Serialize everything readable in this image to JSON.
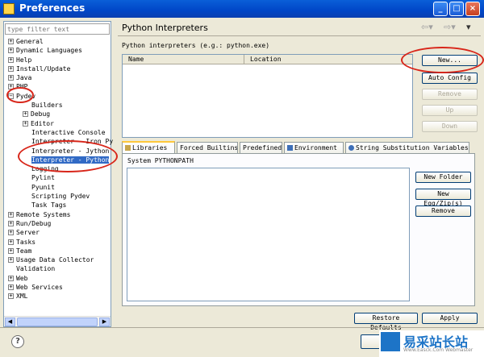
{
  "window": {
    "title": "Preferences"
  },
  "filter": {
    "placeholder": "type filter text"
  },
  "tree": [
    {
      "label": "General",
      "expander": "+",
      "level": 0
    },
    {
      "label": "Dynamic Languages",
      "expander": "+",
      "level": 0
    },
    {
      "label": "Help",
      "expander": "+",
      "level": 0
    },
    {
      "label": "Install/Update",
      "expander": "+",
      "level": 0
    },
    {
      "label": "Java",
      "expander": "+",
      "level": 0
    },
    {
      "label": "PHP",
      "expander": "+",
      "level": 0
    },
    {
      "label": "Pydev",
      "expander": "−",
      "level": 0
    },
    {
      "label": "Builders",
      "expander": "",
      "level": 1
    },
    {
      "label": "Debug",
      "expander": "+",
      "level": 1
    },
    {
      "label": "Editor",
      "expander": "+",
      "level": 1
    },
    {
      "label": "Interactive Console",
      "expander": "",
      "level": 1
    },
    {
      "label": "Interpreter - Iron Py",
      "expander": "",
      "level": 1
    },
    {
      "label": "Interpreter - Jython",
      "expander": "",
      "level": 1
    },
    {
      "label": "Interpreter - Python",
      "expander": "",
      "level": 1,
      "selected": true
    },
    {
      "label": "Logging",
      "expander": "",
      "level": 1
    },
    {
      "label": "Pylint",
      "expander": "",
      "level": 1
    },
    {
      "label": "Pyunit",
      "expander": "",
      "level": 1
    },
    {
      "label": "Scripting Pydev",
      "expander": "",
      "level": 1
    },
    {
      "label": "Task Tags",
      "expander": "",
      "level": 1
    },
    {
      "label": "Remote Systems",
      "expander": "+",
      "level": 0
    },
    {
      "label": "Run/Debug",
      "expander": "+",
      "level": 0
    },
    {
      "label": "Server",
      "expander": "+",
      "level": 0
    },
    {
      "label": "Tasks",
      "expander": "+",
      "level": 0
    },
    {
      "label": "Team",
      "expander": "+",
      "level": 0
    },
    {
      "label": "Usage Data Collector",
      "expander": "+",
      "level": 0
    },
    {
      "label": "Validation",
      "expander": "",
      "level": 0
    },
    {
      "label": "Web",
      "expander": "+",
      "level": 0
    },
    {
      "label": "Web Services",
      "expander": "+",
      "level": 0
    },
    {
      "label": "XML",
      "expander": "+",
      "level": 0
    }
  ],
  "page": {
    "title": "Python Interpreters",
    "interpreters_label": "Python interpreters (e.g.: python.exe)",
    "columns": [
      "Name",
      "Location"
    ],
    "buttons": {
      "new": "New...",
      "auto_config": "Auto Config",
      "remove": "Remove",
      "up": "Up",
      "down": "Down"
    },
    "tabs": [
      "Libraries",
      "Forced Builtins",
      "Predefined",
      "Environment",
      "String Substitution Variables"
    ],
    "libraries": {
      "system_label": "System PYTHONPATH",
      "new_folder": "New Folder",
      "new_egg": "New Egg/Zip(s)",
      "remove": "Remove"
    },
    "restore_defaults": "Restore Defaults",
    "apply": "Apply"
  },
  "watermark": {
    "text": "易采站长站",
    "sub": "Www.Easck.Com Webmaster"
  },
  "colors": {
    "titlebar": "#0046c7",
    "selection": "#316ac5",
    "annotation": "#d8261a"
  }
}
